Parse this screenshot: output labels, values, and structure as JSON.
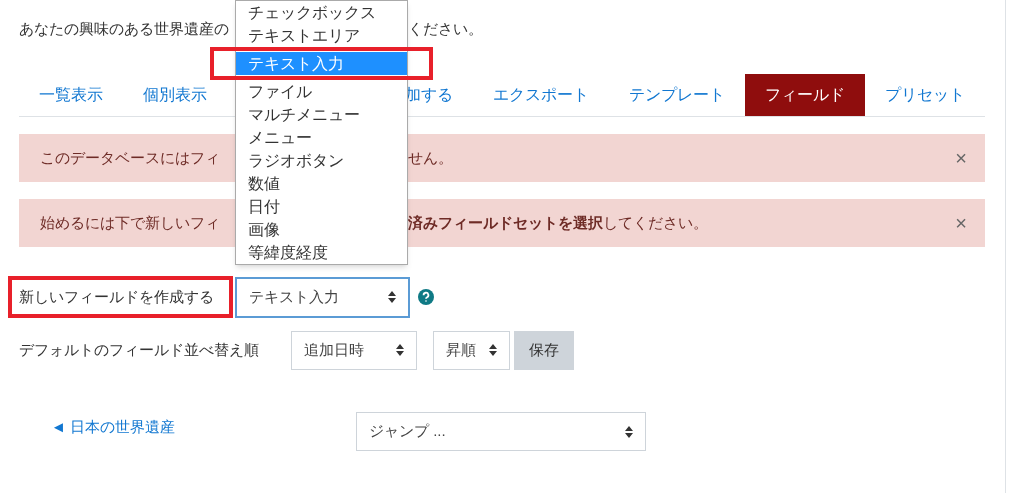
{
  "intro": {
    "text_left": "あなたの興味のある世界遺産の",
    "text_right": "ください。"
  },
  "tabs_left": [
    {
      "label": "一覧表示",
      "selected": false
    },
    {
      "label": "個別表示",
      "selected": false
    }
  ],
  "tabs_right": [
    {
      "label": "加する",
      "selected": false
    },
    {
      "label": "エクスポート",
      "selected": false
    },
    {
      "label": "テンプレート",
      "selected": false
    },
    {
      "label": "フィールド",
      "selected": true
    },
    {
      "label": "プリセット",
      "selected": false
    }
  ],
  "alerts": [
    {
      "text_left": "このデータベースにはフィ",
      "text_right": "せん。",
      "close": "×"
    },
    {
      "text_left": "始めるには下で新しいフィ",
      "text_right": "**済みフィールドセットを選択**してください。",
      "close": "×"
    }
  ],
  "create_field": {
    "label": "新しいフィールドを作成する",
    "select_value": "テキスト入力"
  },
  "sort": {
    "label": "デフォルトのフィールド並べ替え順",
    "field_value": "追加日時",
    "order_value": "昇順",
    "save_button": "保存"
  },
  "footer": {
    "back_link": "◄ 日本の世界遺産",
    "jump_value": "ジャンプ ..."
  },
  "dropdown_menu": [
    {
      "label": "チェックボックス",
      "selected": false
    },
    {
      "label": "テキストエリア",
      "selected": false
    },
    {
      "label": "テキスト入力",
      "selected": true
    },
    {
      "label": "ファイル",
      "selected": false
    },
    {
      "label": "マルチメニュー",
      "selected": false
    },
    {
      "label": "メニュー",
      "selected": false
    },
    {
      "label": "ラジオボタン",
      "selected": false
    },
    {
      "label": "数値",
      "selected": false
    },
    {
      "label": "日付",
      "selected": false
    },
    {
      "label": "画像",
      "selected": false
    },
    {
      "label": "等緯度経度",
      "selected": false
    }
  ]
}
